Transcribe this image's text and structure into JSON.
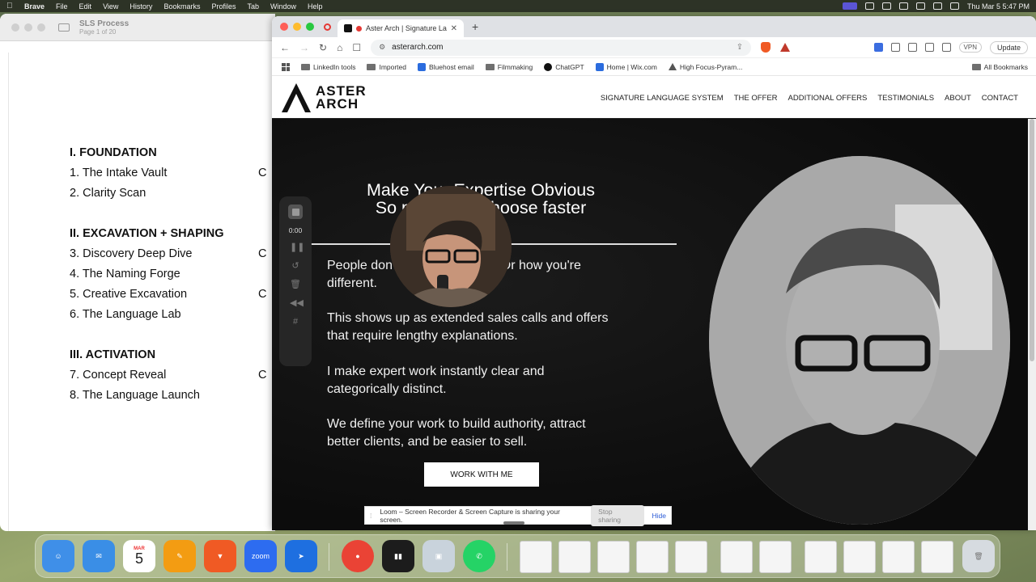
{
  "menubar": {
    "app": "Brave",
    "items": [
      "File",
      "Edit",
      "View",
      "History",
      "Bookmarks",
      "Profiles",
      "Tab",
      "Window",
      "Help"
    ],
    "clock": "Thu Mar 5  5:47 PM"
  },
  "doc_window": {
    "title": "SLS Process",
    "subtitle": "Page 1 of 20",
    "outline": [
      {
        "kind": "section",
        "text": "I.  FOUNDATION"
      },
      {
        "kind": "item",
        "text": "1. The Intake Vault",
        "stray": "C"
      },
      {
        "kind": "item",
        "text": "2. Clarity Scan"
      },
      {
        "kind": "gap"
      },
      {
        "kind": "section",
        "text": "II. EXCAVATION + SHAPING"
      },
      {
        "kind": "item",
        "text": "3. Discovery Deep Dive",
        "stray": "C"
      },
      {
        "kind": "item",
        "text": "4. The Naming Forge"
      },
      {
        "kind": "item",
        "text": "5. Creative Excavation",
        "stray": "C"
      },
      {
        "kind": "item",
        "text": "6. The Language Lab"
      },
      {
        "kind": "gap"
      },
      {
        "kind": "section",
        "text": "III. ACTIVATION"
      },
      {
        "kind": "item",
        "text": "7. Concept Reveal",
        "stray": "C"
      },
      {
        "kind": "item",
        "text": "8. The Language Launch"
      }
    ]
  },
  "browser": {
    "tab_title": "Aster Arch | Signature Lan",
    "url": "asterarch.com",
    "vpn_label": "VPN",
    "update_label": "Update",
    "bookmarks": [
      "LinkedIn tools",
      "Imported",
      "Bluehost email",
      "Filmmaking",
      "ChatGPT",
      "Home | Wix.com",
      "High Focus-Pyram..."
    ],
    "all_bookmarks": "All Bookmarks"
  },
  "site": {
    "logo_line1": "ASTER",
    "logo_line2": "ARCH",
    "nav": [
      "SIGNATURE LANGUAGE SYSTEM",
      "THE OFFER",
      "ADDITIONAL OFFERS",
      "TESTIMONIALS",
      "ABOUT",
      "CONTACT"
    ],
    "headline_1": "Make Your Expertise Obvious",
    "headline_2": "So prospects choose faster",
    "paragraphs": [
      "People don't get what you do. Or how you're different.",
      "This shows up as extended sales calls and offers that require lengthy explanations.",
      "I make expert work instantly clear and categorically distinct.",
      "We define your work to build authority, attract better clients, and be easier to sell."
    ],
    "cta": "WORK WITH ME"
  },
  "loom": {
    "timer": "0:00",
    "share_message": "Loom – Screen Recorder & Screen Capture is sharing your screen.",
    "stop_label": "Stop sharing",
    "hide_label": "Hide"
  },
  "dock": {
    "calendar_month": "MAR",
    "calendar_day": "5",
    "zoom_label": "zoom"
  },
  "colors": {
    "accent_record": "#e53935",
    "brave_orange": "#f05a24",
    "hero_bg": "#0c0c0c"
  }
}
